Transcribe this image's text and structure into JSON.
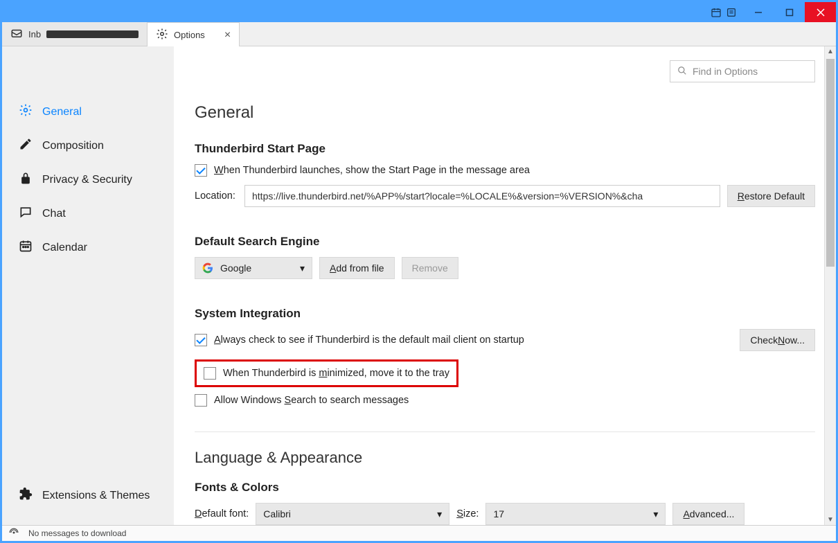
{
  "tabs": {
    "inbox_prefix": "Inb",
    "options": "Options"
  },
  "search": {
    "placeholder": "Find in Options"
  },
  "sidebar": {
    "general": "General",
    "composition": "Composition",
    "privacy": "Privacy & Security",
    "chat": "Chat",
    "calendar": "Calendar",
    "extensions": "Extensions & Themes"
  },
  "general": {
    "heading": "General",
    "start_page_heading": "Thunderbird Start Page",
    "show_start_page": "hen Thunderbird launches, show the Start Page in the message area",
    "location_label": "Location:",
    "location_value": "https://live.thunderbird.net/%APP%/start?locale=%LOCALE%&version=%VERSION%&cha",
    "restore_default": "estore Default",
    "search_engine_heading": "Default Search Engine",
    "search_engine_value": "Google",
    "add_from_file": "dd from file",
    "remove": "Remove",
    "system_integration_heading": "System Integration",
    "default_client_check": "lways check to see if Thunderbird is the default mail client on startup",
    "check_now": "ow...",
    "minimize_tray": "inimized, move it to the tray",
    "minimize_tray_prefix": "When Thunderbird is ",
    "windows_search": "earch to search messages",
    "windows_search_prefix": "Allow Windows ",
    "lang_heading": "Language & Appearance",
    "fonts_heading": "Fonts & Colors",
    "default_font_label": "efault font:",
    "default_font_value": "Calibri",
    "size_label": "ize:",
    "size_value": "17",
    "advanced": "dvanced..."
  },
  "statusbar": {
    "message": "No messages to download"
  }
}
